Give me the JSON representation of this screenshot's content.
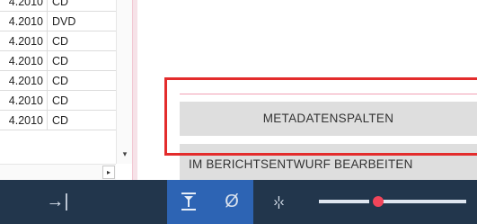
{
  "table": {
    "rows": [
      {
        "date": "4.2010",
        "type": "CD"
      },
      {
        "date": "4.2010",
        "type": "DVD"
      },
      {
        "date": "4.2010",
        "type": "CD"
      },
      {
        "date": "4.2010",
        "type": "CD"
      },
      {
        "date": "4.2010",
        "type": "CD"
      },
      {
        "date": "4.2010",
        "type": "CD"
      },
      {
        "date": "4.2010",
        "type": "CD"
      }
    ],
    "scroll_down_glyph": "▾",
    "scroll_right_glyph": "▸"
  },
  "panel": {
    "metadata_button": "METADATENSPALTEN",
    "edit_button": "IM BERICHTSENTWURF BEARBEITEN",
    "highlight_color": "#e32c2c"
  },
  "toolbar": {
    "background": "#22364c",
    "active_color": "#2d64b4",
    "expand_glyph": "→|",
    "fit_icon": "fit-height-icon",
    "none_glyph": "Ø",
    "split_glyph": "›¦‹",
    "slider_value": 0.4,
    "slider_thumb_color": "#f2455a"
  }
}
